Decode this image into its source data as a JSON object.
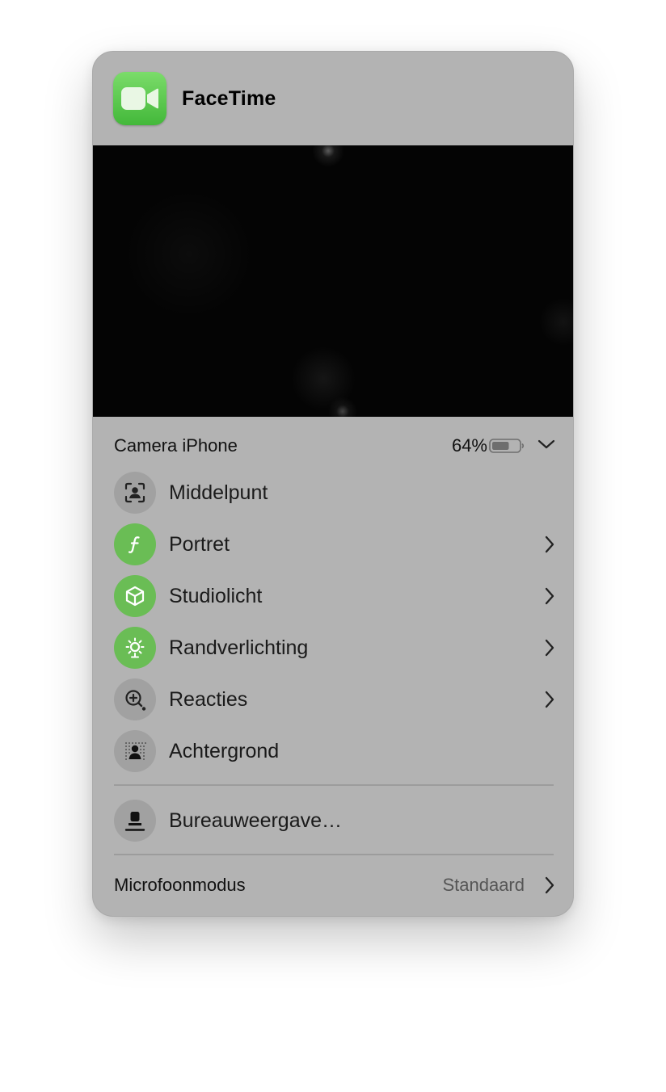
{
  "app": {
    "title": "FaceTime",
    "icon": "facetime-icon"
  },
  "camera": {
    "name": "Camera iPhone",
    "battery": "64%",
    "battery_level": 0.64
  },
  "effects": [
    {
      "label": "Middelpunt",
      "icon": "center-stage-icon",
      "enabled": false,
      "has_submenu": false
    },
    {
      "label": "Portret",
      "icon": "portrait-icon",
      "enabled": true,
      "has_submenu": true
    },
    {
      "label": "Studiolicht",
      "icon": "studio-light-icon",
      "enabled": true,
      "has_submenu": true
    },
    {
      "label": "Randverlichting",
      "icon": "edge-light-icon",
      "enabled": true,
      "has_submenu": true
    },
    {
      "label": "Reacties",
      "icon": "reactions-icon",
      "enabled": false,
      "has_submenu": true
    },
    {
      "label": "Achtergrond",
      "icon": "background-icon",
      "enabled": false,
      "has_submenu": false
    }
  ],
  "desk_view": {
    "label": "Bureauweergave…",
    "icon": "desk-view-icon"
  },
  "mic_mode": {
    "label": "Microfoonmodus",
    "value": "Standaard"
  },
  "colors": {
    "panel_bg": "#b3b3b3",
    "enabled_green": "#6abd55",
    "disabled_gray": "#a1a1a1"
  }
}
